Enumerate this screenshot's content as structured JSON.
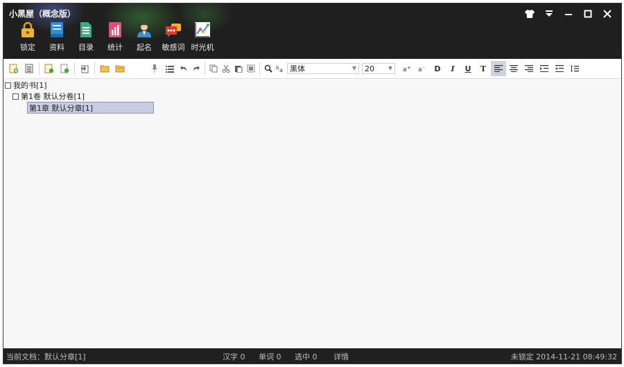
{
  "app": {
    "title": "小黑屋（概念版）"
  },
  "window_buttons": [
    "shirt-icon",
    "dropdown-icon",
    "minimize-icon",
    "maximize-icon",
    "close-icon"
  ],
  "ribbon": [
    {
      "label": "锁定",
      "icon": "lock-icon",
      "color": "#f0b429"
    },
    {
      "label": "资料",
      "icon": "book-icon",
      "color": "#2e8fd6"
    },
    {
      "label": "目录",
      "icon": "list-icon",
      "color": "#3cae7c"
    },
    {
      "label": "统计",
      "icon": "chart-icon",
      "color": "#e84c7a"
    },
    {
      "label": "起名",
      "icon": "person-icon",
      "color": "#d9a27a"
    },
    {
      "label": "敏感词",
      "icon": "chat-icon",
      "color": "#e03a2f"
    },
    {
      "label": "时光机",
      "icon": "graph-icon",
      "color": "#ffffff"
    }
  ],
  "toolbar": {
    "font": "黑体",
    "size": "20",
    "bold": "D",
    "italic": "I",
    "underline": "U",
    "strike": "T"
  },
  "tree": {
    "book": "我的书[1]",
    "volume": "第1卷 默认分卷[1]",
    "chapter": "第1章 默认分章[1]"
  },
  "status": {
    "current_doc": "当前文档：默认分章[1]",
    "chars": "汉字 0",
    "words": "单词 0",
    "selected": "选中 0",
    "details": "详情",
    "lock_time": "未锁定 2014-11-21  08:49:32"
  }
}
